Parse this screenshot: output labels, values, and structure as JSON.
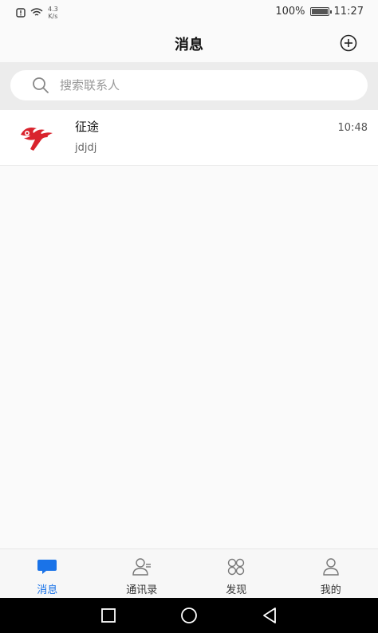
{
  "status_bar": {
    "net_speed_value": "4.3",
    "net_speed_unit": "K/s",
    "battery": "100%",
    "battery_level": 1.0,
    "time": "11:27"
  },
  "header": {
    "title": "消息",
    "add_icon": "plus-circle-icon"
  },
  "search": {
    "placeholder": "搜索联系人",
    "icon": "search-icon"
  },
  "conversations": [
    {
      "name": "征途",
      "preview": "jdjdj",
      "time": "10:48",
      "avatar": "red-logo-avatar"
    }
  ],
  "tabs": [
    {
      "label": "消息",
      "icon": "chat-bubble-icon",
      "active": true
    },
    {
      "label": "通讯录",
      "icon": "contacts-icon",
      "active": false
    },
    {
      "label": "发现",
      "icon": "discover-icon",
      "active": false
    },
    {
      "label": "我的",
      "icon": "profile-icon",
      "active": false
    }
  ],
  "colors": {
    "accent": "#1a73e8",
    "logo_red": "#d9232d"
  },
  "nav_bar": {
    "buttons": [
      "square-recent-icon",
      "circle-home-icon",
      "triangle-back-icon"
    ]
  }
}
